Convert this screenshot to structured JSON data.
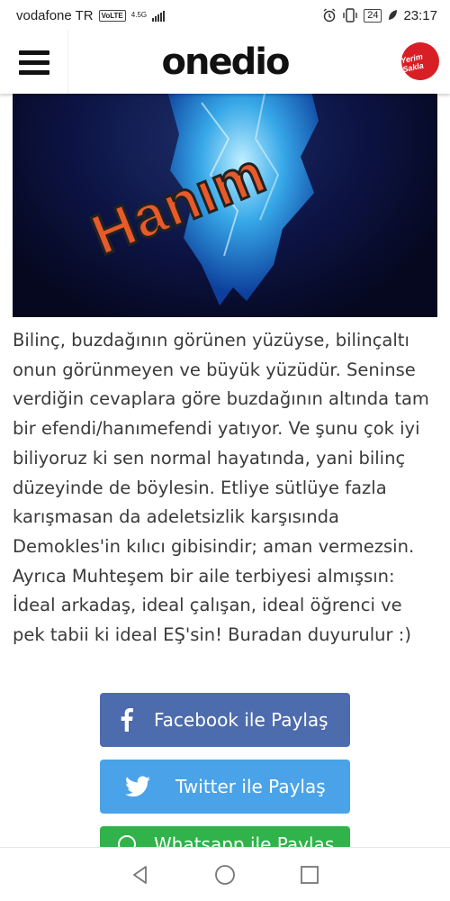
{
  "status_bar": {
    "carrier": "vodafone TR",
    "volte": "VoLTE",
    "network": "4.5G",
    "battery": "24",
    "time": "23:17"
  },
  "header": {
    "logo": "onedio",
    "badge_text": "Yerim Sakla",
    "menu_icon": "hamburger-icon"
  },
  "hero": {
    "overlay_text": "Hanım"
  },
  "article": {
    "text": "Bilinç, buzdağının görünen yüzüyse, bilinçaltı onun görünmeyen ve büyük yüzüdür. Seninse verdiğin cevaplara göre buzdağının altında tam bir efendi/hanımefendi yatıyor. Ve şunu çok iyi biliyoruz ki sen normal hayatında, yani bilinç düzeyinde de böylesin. Etliye sütlüye fazla karışmasan da adeletsizlik karşısında Demokles'in kılıcı gibisindir; aman vermezsin. Ayrıca Muhteşem bir aile terbiyesi almışsın: İdeal arkadaş, ideal çalışan, ideal öğrenci ve pek tabii ki ideal EŞ'sin! Buradan duyurulur :)"
  },
  "share": {
    "facebook": "Facebook ile Paylaş",
    "twitter": "Twitter ile Paylaş",
    "whatsapp": "Whatsapp ile Paylaş"
  },
  "colors": {
    "facebook": "#4d6cad",
    "twitter": "#4aa3e8",
    "whatsapp": "#2fb34a"
  }
}
